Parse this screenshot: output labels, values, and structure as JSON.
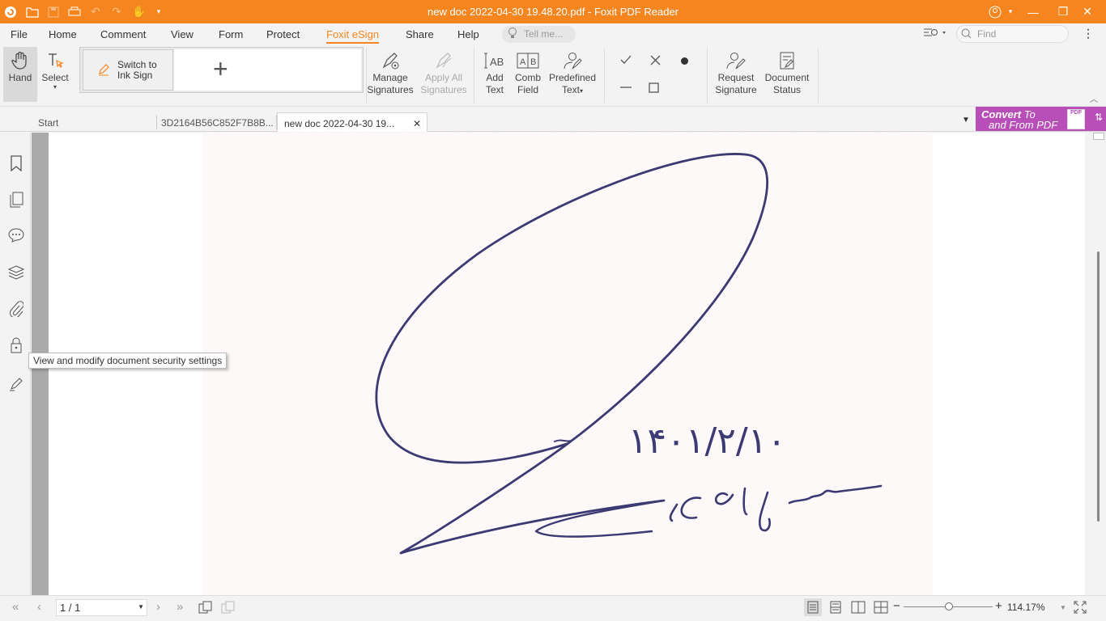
{
  "window": {
    "title": "new doc 2022-04-30 19.48.20.pdf - Foxit PDF Reader",
    "accent": "#f5861f"
  },
  "menu": {
    "items": [
      "File",
      "Home",
      "Comment",
      "View",
      "Form",
      "Protect",
      "Foxit eSign",
      "Share",
      "Help"
    ],
    "active": "Foxit eSign",
    "tell_me_placeholder": "Tell me...",
    "find_placeholder": "Find"
  },
  "ribbon": {
    "hand": "Hand",
    "select": "Select",
    "switch_ink_line1": "Switch to",
    "switch_ink_line2": "Ink Sign",
    "add_signature": "+",
    "manage_line1": "Manage",
    "manage_line2": "Signatures",
    "apply_line1": "Apply All",
    "apply_line2": "Signatures",
    "addtext_line1": "Add",
    "addtext_line2": "Text",
    "comb_line1": "Comb",
    "comb_line2": "Field",
    "predef_line1": "Predefined",
    "predef_line2": "Text",
    "request_line1": "Request",
    "request_line2": "Signature",
    "docstatus_line1": "Document",
    "docstatus_line2": "Status"
  },
  "tabs": [
    {
      "label": "Start"
    },
    {
      "label": "3D2164B56C852F7B8B..."
    },
    {
      "label": "new doc 2022-04-30 19..."
    }
  ],
  "convert_banner": {
    "line1": "Convert",
    "line1b": "To",
    "line2": "and From PDF",
    "badge": "PDF"
  },
  "tooltip": "View and modify document security settings",
  "signature_text": {
    "date": "۱۴۰۱/۲/۱۰"
  },
  "status": {
    "page_indicator": "1 / 1",
    "zoom": "114.17%"
  },
  "icons": {
    "left_panel": [
      "bookmark-icon",
      "pages-icon",
      "comments-icon",
      "layers-icon",
      "attachment-icon",
      "lock-icon",
      "signature-panel-icon"
    ]
  }
}
